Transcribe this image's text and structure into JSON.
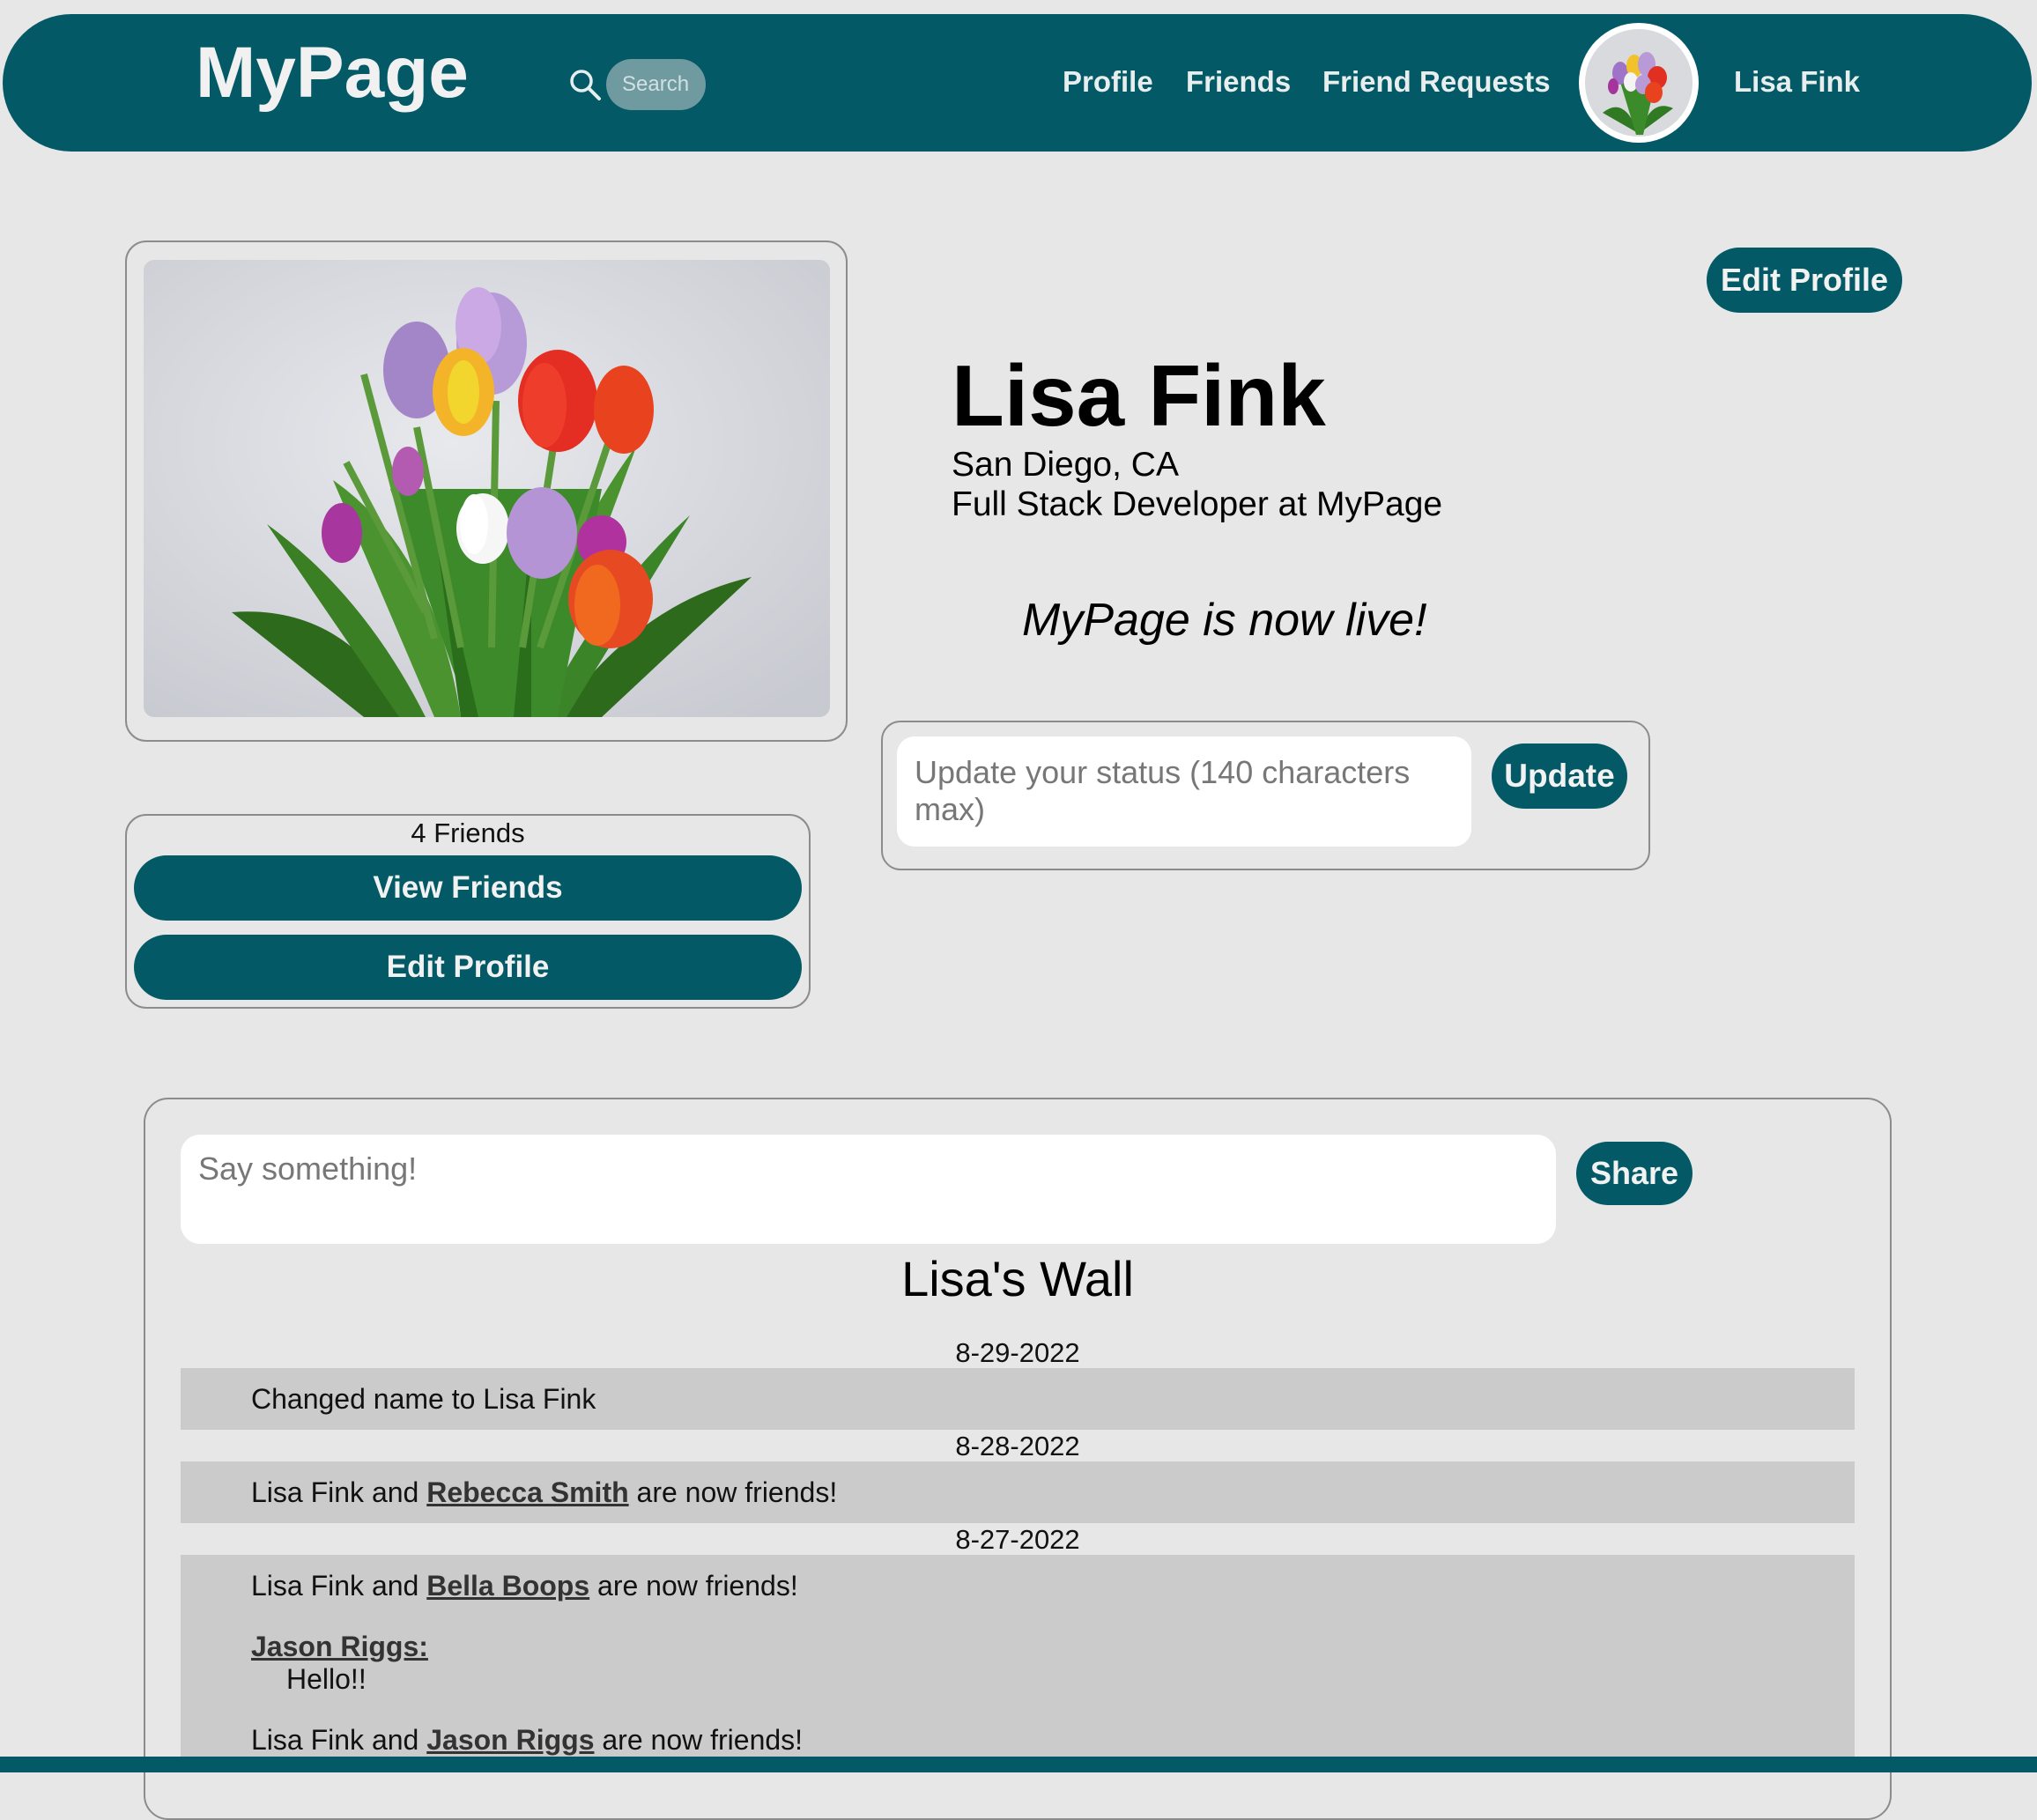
{
  "header": {
    "brand": "MyPage",
    "search_placeholder": "Search",
    "nav": [
      "Profile",
      "Friends",
      "Friend Requests"
    ],
    "user_name": "Lisa Fink",
    "background_color": "#035a66"
  },
  "profile": {
    "edit_label": "Edit Profile",
    "name": "Lisa Fink",
    "location": "San Diego, CA",
    "job": "Full Stack Developer at MyPage",
    "status": "MyPage is now live!",
    "status_placeholder": "Update your status (140 characters max)",
    "update_label": "Update",
    "photo_icon": "tulip-bouquet"
  },
  "friends_box": {
    "count_label": "4 Friends",
    "view_label": "View Friends",
    "edit_label": "Edit Profile"
  },
  "wall": {
    "post_placeholder": "Say something!",
    "share_label": "Share",
    "title": "Lisa's Wall",
    "dates": [
      "8-29-2022",
      "8-28-2022",
      "8-27-2022"
    ],
    "entry1": "Changed name to Lisa Fink",
    "prefix": "Lisa Fink and",
    "suffix": "are now friends!",
    "friend1": "Rebecca Smith",
    "friend2": "Bella Boops",
    "comment_author": "Jason Riggs:",
    "comment_text": "Hello!!",
    "friend3": "Jason Riggs"
  },
  "colors": {
    "accent": "#035a66",
    "background": "#e7e7e7",
    "row": "#cbcbcb"
  }
}
